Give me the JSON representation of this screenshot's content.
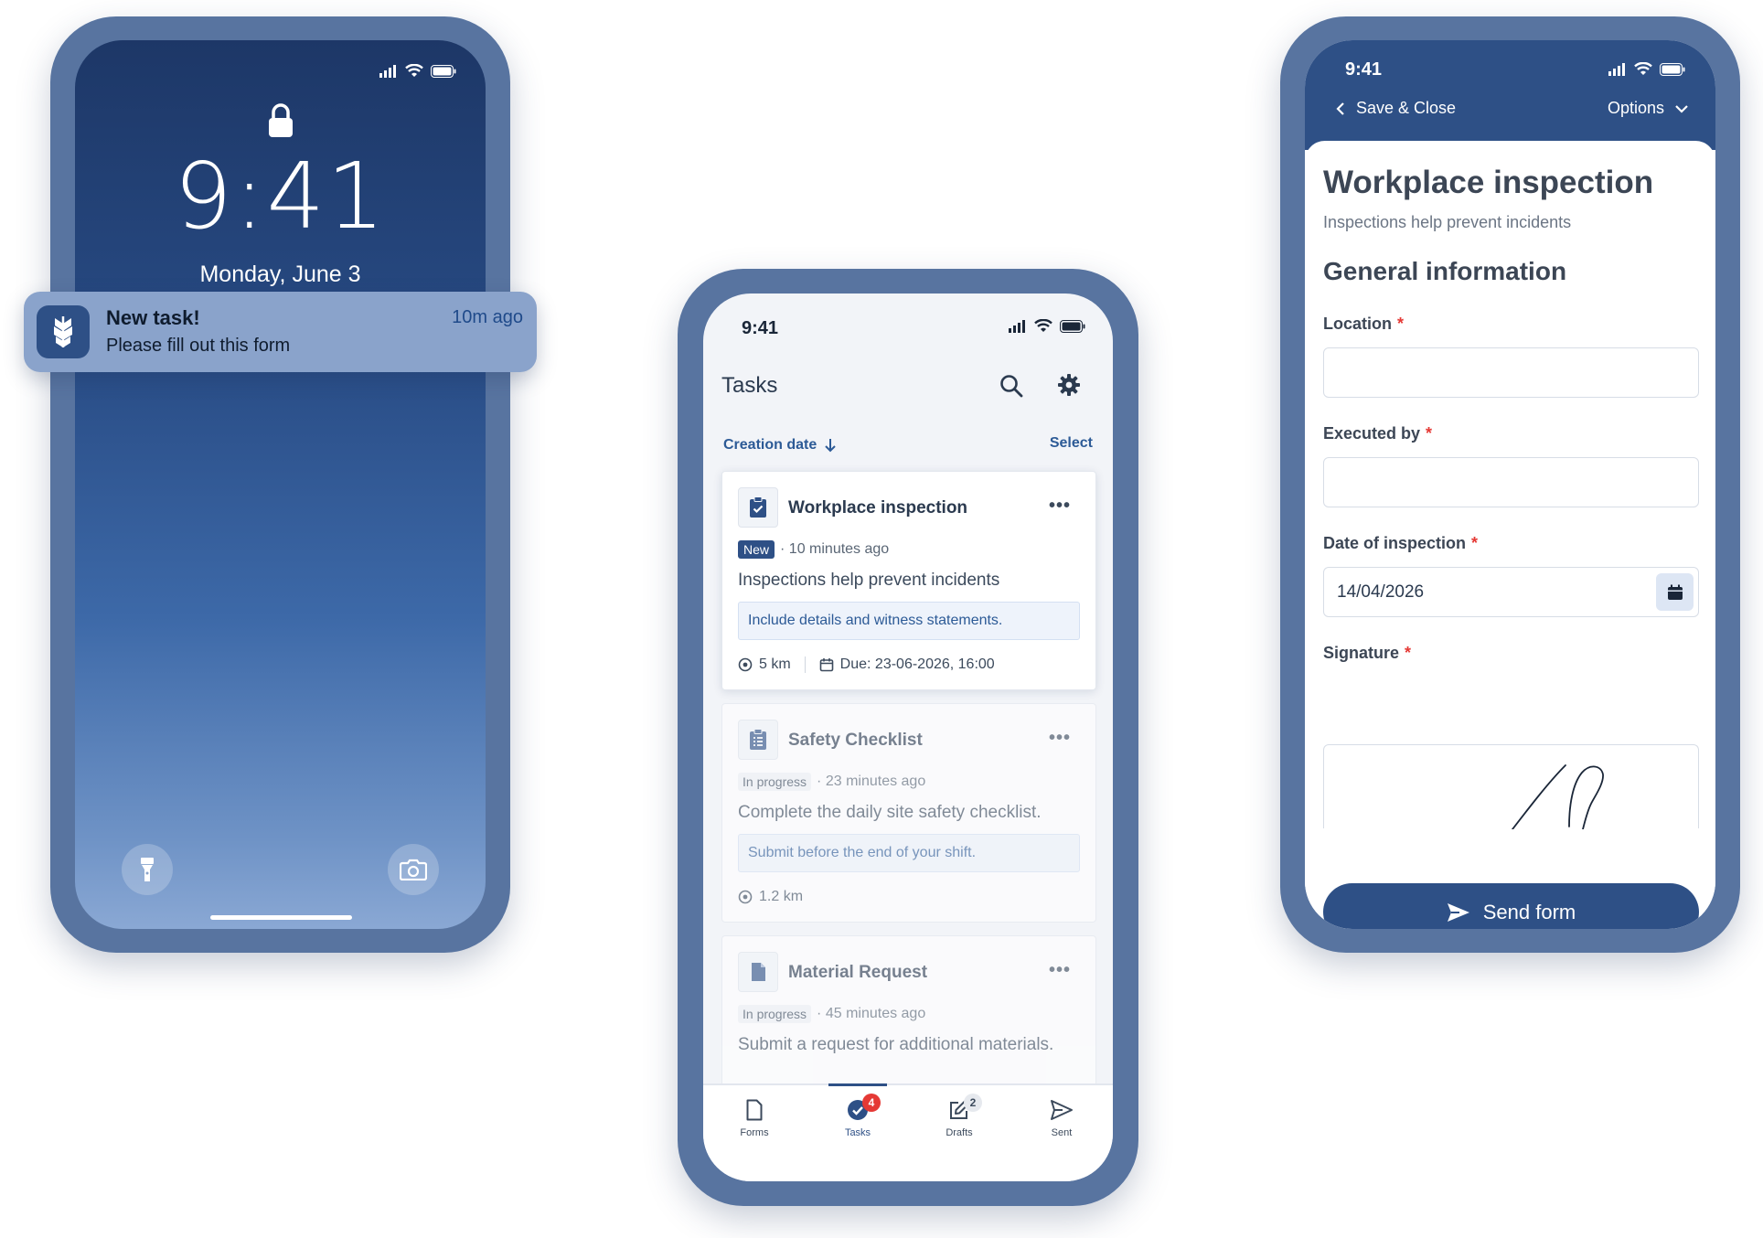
{
  "lock_screen": {
    "time": "9:41",
    "date": "Monday, June 3",
    "notification": {
      "title": "New task!",
      "body": "Please fill out this form",
      "time_ago": "10m ago"
    },
    "icons": [
      "signal-icon",
      "wifi-icon",
      "battery-icon",
      "lock-icon",
      "flashlight-icon",
      "camera-icon"
    ]
  },
  "tasks_screen": {
    "status_time": "9:41",
    "title": "Tasks",
    "sort_label": "Creation date",
    "select_label": "Select",
    "cards": [
      {
        "title": "Workplace inspection",
        "badge": "New",
        "time_ago": "· 10 minutes ago",
        "description": "Inspections help prevent incidents",
        "note": "Include details and witness statements.",
        "distance": "5 km",
        "due": "Due: 23-06-2026, 16:00"
      },
      {
        "title": "Safety Checklist",
        "badge": "In progress",
        "time_ago": "· 23 minutes ago",
        "description": "Complete the daily site safety checklist.",
        "note": "Submit before the end of your shift.",
        "distance": "1.2 km"
      },
      {
        "title": "Material Request",
        "badge": "In progress",
        "time_ago": "· 45 minutes ago",
        "description": "Submit a request for additional materials."
      }
    ],
    "tabs": [
      {
        "label": "Forms"
      },
      {
        "label": "Tasks",
        "badge": "4"
      },
      {
        "label": "Drafts",
        "badge": "2"
      },
      {
        "label": "Sent"
      }
    ],
    "active_tab": "Tasks"
  },
  "form_screen": {
    "status_time": "9:41",
    "back_label": "Save & Close",
    "options_label": "Options",
    "title": "Workplace inspection",
    "subtitle": "Inspections help prevent incidents",
    "section": "General information",
    "required_marker": "*",
    "fields": {
      "location": {
        "label": "Location",
        "value": ""
      },
      "executed_by": {
        "label": "Executed by",
        "value": ""
      },
      "date": {
        "label": "Date of inspection",
        "value": "14/04/2026"
      },
      "signature": {
        "label": "Signature"
      }
    },
    "send_label": "Send form"
  },
  "colors": {
    "frame": "#5874a0",
    "brand": "#2e5086",
    "accent_link": "#2c5a96",
    "required": "#e53935",
    "badge_red": "#e53935"
  }
}
